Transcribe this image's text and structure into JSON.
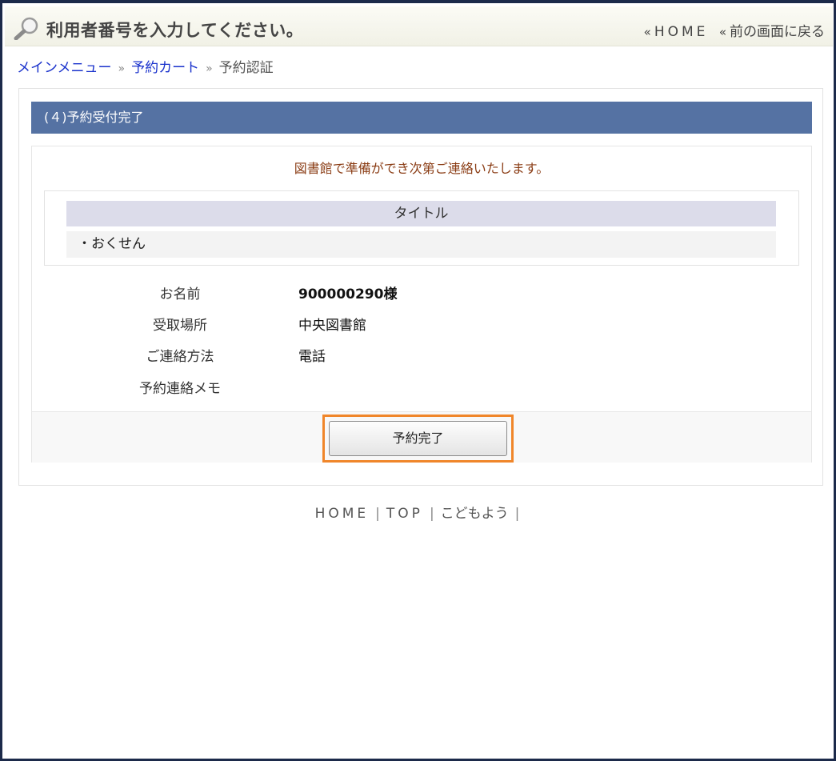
{
  "header": {
    "title": "利用者番号を入力してください。",
    "raquo": "«",
    "home_link": "HOME",
    "back_link": "前の画面に戻る",
    "icon": "magnifier-icon"
  },
  "breadcrumb": {
    "items": [
      "メインメニュー",
      "予約カート"
    ],
    "separator": "»",
    "current": "予約認証"
  },
  "section": {
    "heading": "(４)予約受付完了",
    "notice": "図書館で準備ができ次第ご連絡いたします。"
  },
  "title_table": {
    "header": "タイトル",
    "rows": [
      "・おくせん"
    ]
  },
  "details": [
    {
      "label": "お名前",
      "value": "900000290様"
    },
    {
      "label": "受取場所",
      "value": "中央図書館"
    },
    {
      "label": "ご連絡方法",
      "value": "電話"
    },
    {
      "label": "予約連絡メモ",
      "value": ""
    }
  ],
  "actions": {
    "complete_button": "予約完了"
  },
  "footer": {
    "links": [
      "HOME",
      "TOP",
      "こどもよう"
    ],
    "separator": "|"
  },
  "colors": {
    "section_head": "#5572a3",
    "notice_text": "#8a3c14",
    "highlight": "#f0862a",
    "link": "#1a32cc"
  }
}
